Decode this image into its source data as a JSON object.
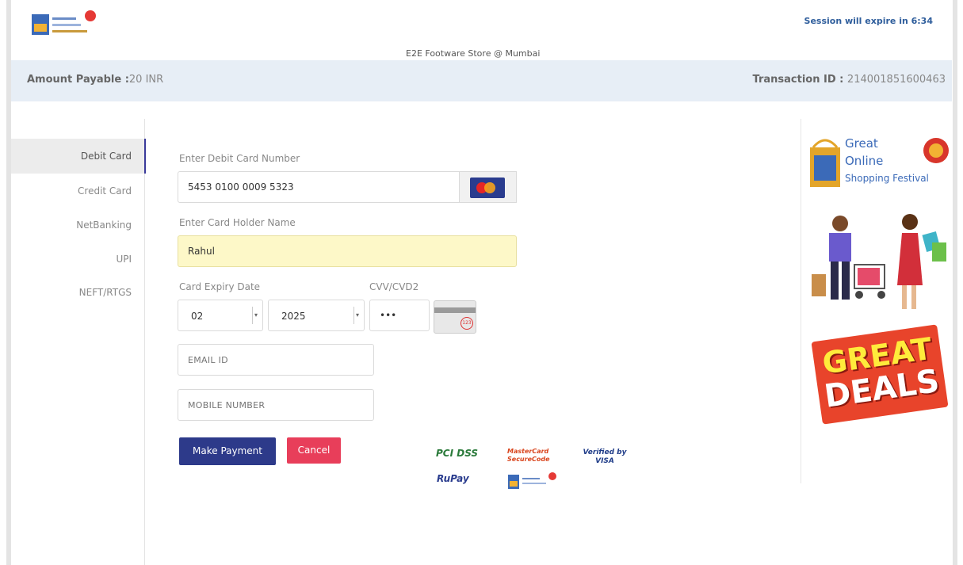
{
  "header": {
    "session_text": "Session will expire in 6:34",
    "store_name": "E2E Footware Store @ Mumbai",
    "amount_label": "Amount Payable :",
    "amount_value": "20 INR",
    "transaction_label": "Transaction ID :",
    "transaction_value": "214001851600463"
  },
  "sidebar": {
    "items": [
      {
        "label": "Debit Card"
      },
      {
        "label": "Credit Card"
      },
      {
        "label": "NetBanking"
      },
      {
        "label": "UPI"
      },
      {
        "label": "NEFT/RTGS"
      }
    ]
  },
  "form": {
    "card_number_label": "Enter Debit Card Number",
    "card_number_value": "5453 0100 0009 5323",
    "holder_label": "Enter Card Holder Name",
    "holder_value": "Rahul",
    "expiry_label": "Card Expiry Date",
    "expiry_month": "02",
    "expiry_year": "2025",
    "cvv_label": "CVV/CVD2",
    "cvv_value": "•••",
    "email_placeholder": "EMAIL ID",
    "mobile_placeholder": "MOBILE NUMBER",
    "pay_button": "Make Payment",
    "cancel_button": "Cancel"
  },
  "badges": {
    "pci": "PCI DSS",
    "rupay": "RuPay",
    "mastercard": "MasterCard SecureCode",
    "visa": "Verified by VISA"
  },
  "promo": {
    "line1": "Great",
    "line2": "Online",
    "line3": "Shopping Festival",
    "deal1": "GREAT",
    "deal2": "DEALS"
  },
  "colors": {
    "band": "#e7eef6",
    "pay_button": "#2d3a8a",
    "cancel_button": "#e83e5a",
    "session_text": "#2f5e9c"
  }
}
